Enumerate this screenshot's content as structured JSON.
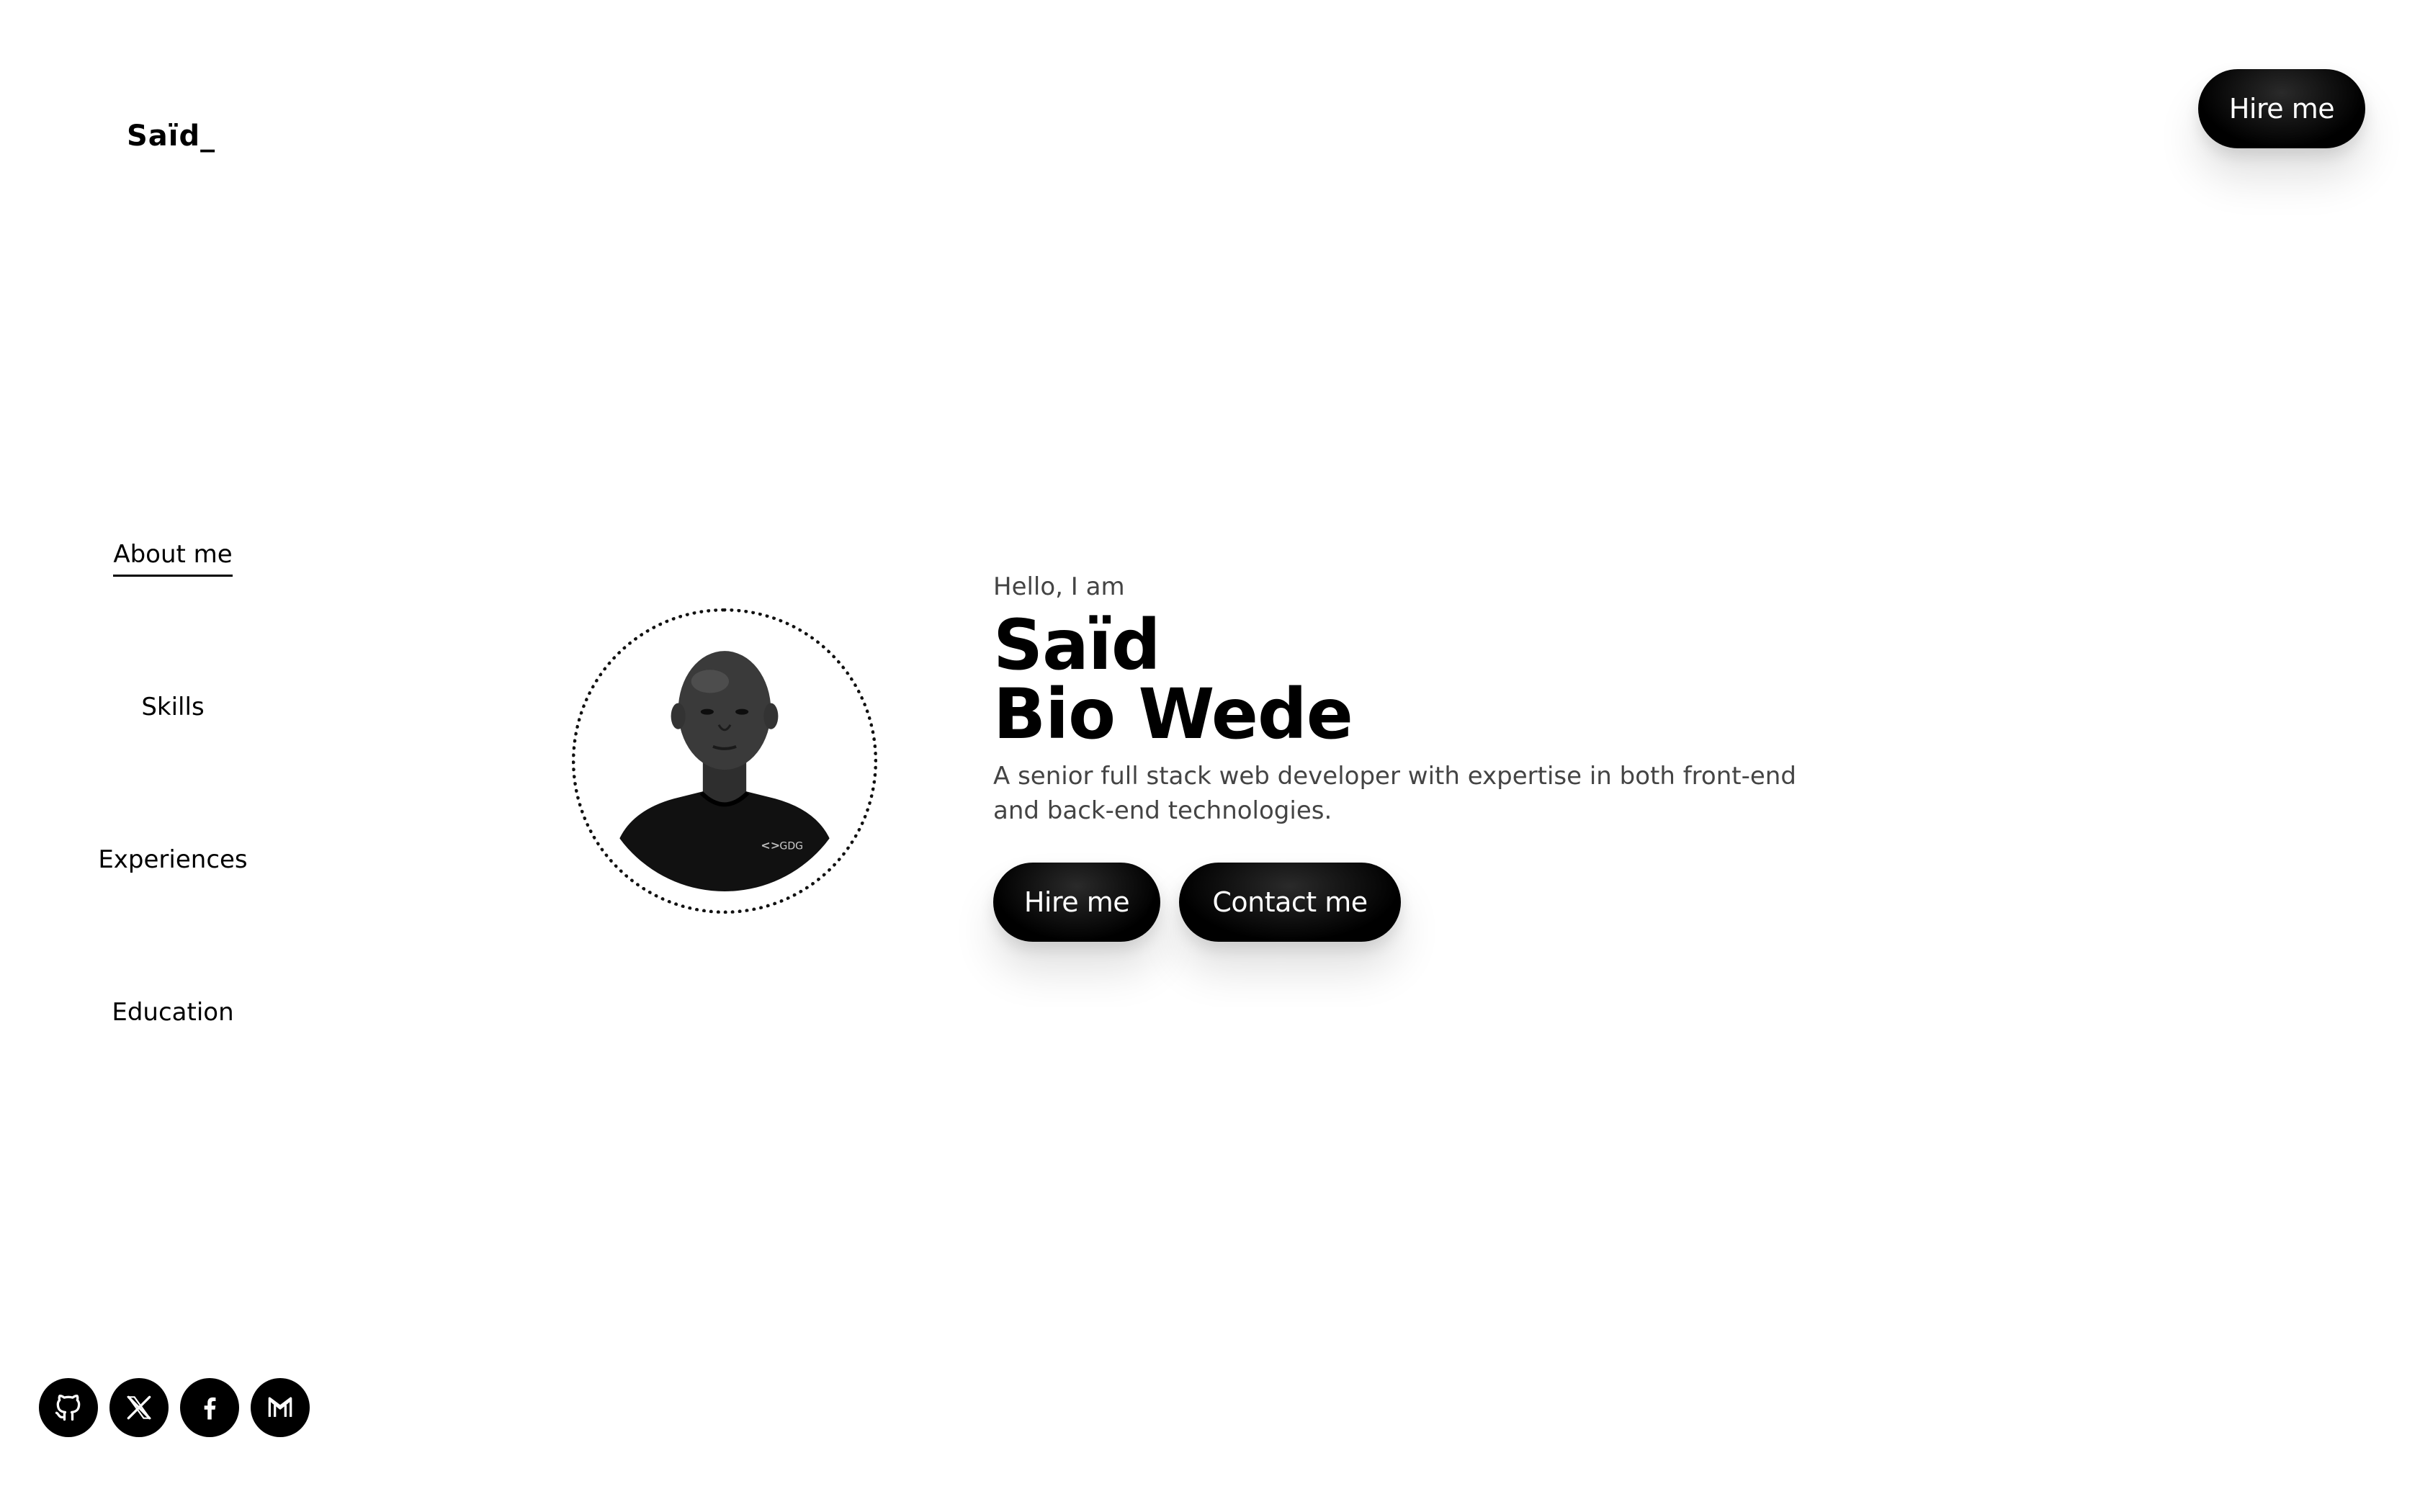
{
  "brand": {
    "logo": "Saïd_"
  },
  "header": {
    "hire_label": "Hire me"
  },
  "nav": {
    "items": [
      {
        "label": "About me",
        "active": true
      },
      {
        "label": "Skills",
        "active": false
      },
      {
        "label": "Experiences",
        "active": false
      },
      {
        "label": "Education",
        "active": false
      }
    ]
  },
  "hero": {
    "greeting": "Hello, I am",
    "name_line1": "Saïd",
    "name_line2": "Bio Wede",
    "description": "A senior full stack web developer with expertise in both front-end and back-end technologies.",
    "hire_label": "Hire me",
    "contact_label": "Contact me",
    "shirt_text": "GDG"
  },
  "socials": [
    {
      "icon": "github-icon"
    },
    {
      "icon": "x-icon"
    },
    {
      "icon": "facebook-icon"
    },
    {
      "icon": "gmail-icon"
    }
  ],
  "colors": {
    "background": "#ffffff",
    "primary": "#000000",
    "muted_text": "#444444"
  }
}
